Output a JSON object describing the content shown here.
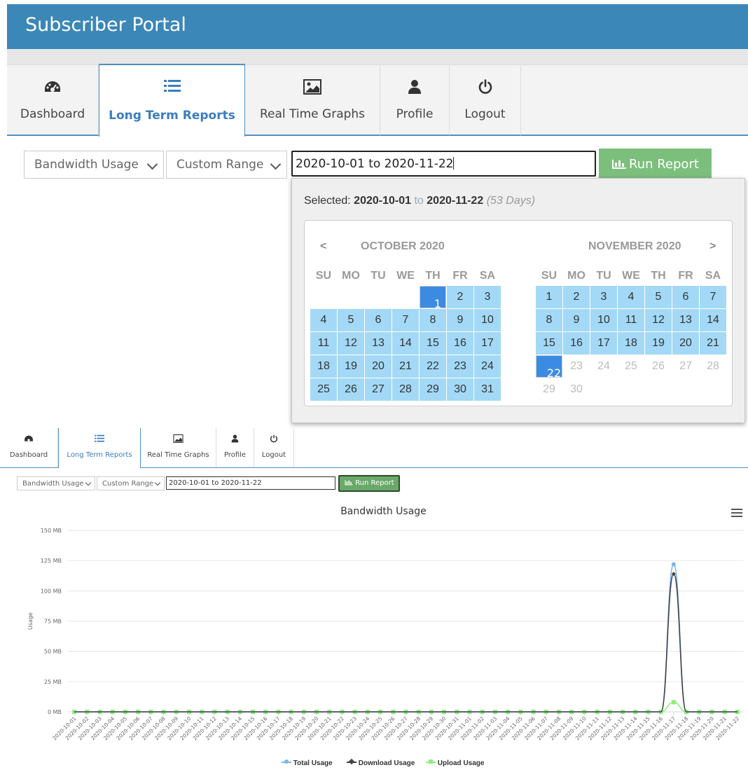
{
  "app": {
    "title": "Subscriber Portal"
  },
  "tabs": [
    {
      "label": "Dashboard",
      "icon": "dashboard-icon"
    },
    {
      "label": "Long Term Reports",
      "icon": "list-icon"
    },
    {
      "label": "Real Time Graphs",
      "icon": "image-icon"
    },
    {
      "label": "Profile",
      "icon": "user-icon"
    },
    {
      "label": "Logout",
      "icon": "power-icon"
    }
  ],
  "controls": {
    "report_type": "Bandwidth Usage",
    "range_type": "Custom Range",
    "date_range": "2020-10-01 to 2020-11-22",
    "run_label": "Run Report"
  },
  "picker": {
    "selected_prefix": "Selected:",
    "start": "2020-10-01",
    "to": "to",
    "end": "2020-11-22",
    "days": "(53 Days)",
    "prev": "<",
    "next": ">",
    "weekdays": [
      "SU",
      "MO",
      "TU",
      "WE",
      "TH",
      "FR",
      "SA"
    ],
    "months": [
      {
        "name": "OCTOBER 2020",
        "first_weekday": 4,
        "days": 31,
        "selected_days": [
          1
        ],
        "in_range_from": 1,
        "in_range_to": 31
      },
      {
        "name": "NOVEMBER 2020",
        "first_weekday": 0,
        "days": 30,
        "selected_days": [
          22
        ],
        "in_range_from": 1,
        "in_range_to": 22
      }
    ]
  },
  "chart_data": {
    "type": "line",
    "title": "Bandwidth Usage",
    "ylabel": "Usage",
    "xlabel": "",
    "ylim": [
      0,
      150
    ],
    "y_ticks": [
      "0 MB",
      "25 MB",
      "50 MB",
      "75 MB",
      "100 MB",
      "125 MB",
      "150 MB"
    ],
    "y_tick_values": [
      0,
      25,
      50,
      75,
      100,
      125,
      150
    ],
    "x": [
      "2020-10-01",
      "2020-10-02",
      "2020-10-03",
      "2020-10-04",
      "2020-10-05",
      "2020-10-06",
      "2020-10-07",
      "2020-10-08",
      "2020-10-09",
      "2020-10-10",
      "2020-10-11",
      "2020-10-12",
      "2020-10-13",
      "2020-10-14",
      "2020-10-15",
      "2020-10-16",
      "2020-10-17",
      "2020-10-18",
      "2020-10-19",
      "2020-10-20",
      "2020-10-21",
      "2020-10-22",
      "2020-10-23",
      "2020-10-24",
      "2020-10-25",
      "2020-10-26",
      "2020-10-27",
      "2020-10-28",
      "2020-10-29",
      "2020-10-30",
      "2020-10-31",
      "2020-11-01",
      "2020-11-02",
      "2020-11-03",
      "2020-11-04",
      "2020-11-05",
      "2020-11-06",
      "2020-11-07",
      "2020-11-08",
      "2020-11-09",
      "2020-11-10",
      "2020-11-11",
      "2020-11-12",
      "2020-11-13",
      "2020-11-14",
      "2020-11-15",
      "2020-11-16",
      "2020-11-17",
      "2020-11-18",
      "2020-11-19",
      "2020-11-20",
      "2020-11-21",
      "2020-11-22"
    ],
    "series": [
      {
        "name": "Total Usage",
        "color": "#7cb5ec",
        "values": [
          0,
          0,
          0,
          0,
          0,
          0,
          0,
          0,
          0,
          0,
          0,
          0,
          0,
          0,
          0,
          0,
          0,
          0,
          0,
          0,
          0,
          0,
          0,
          0,
          0,
          0,
          0,
          0,
          0,
          0,
          0,
          0,
          0,
          0,
          0,
          0,
          0,
          0,
          0,
          0,
          0,
          0,
          0,
          0,
          0,
          0,
          0,
          122,
          0,
          0,
          0,
          0,
          0
        ]
      },
      {
        "name": "Download Usage",
        "color": "#434348",
        "values": [
          0,
          0,
          0,
          0,
          0,
          0,
          0,
          0,
          0,
          0,
          0,
          0,
          0,
          0,
          0,
          0,
          0,
          0,
          0,
          0,
          0,
          0,
          0,
          0,
          0,
          0,
          0,
          0,
          0,
          0,
          0,
          0,
          0,
          0,
          0,
          0,
          0,
          0,
          0,
          0,
          0,
          0,
          0,
          0,
          0,
          0,
          0,
          114,
          0,
          0,
          0,
          0,
          0
        ]
      },
      {
        "name": "Upload Usage",
        "color": "#90ed7d",
        "values": [
          0,
          0,
          0,
          0,
          0,
          0,
          0,
          0,
          0,
          0,
          0,
          0,
          0,
          0,
          0,
          0,
          0,
          0,
          0,
          0,
          0,
          0,
          0,
          0,
          0,
          0,
          0,
          0,
          0,
          0,
          0,
          0,
          0,
          0,
          0,
          0,
          0,
          0,
          0,
          0,
          0,
          0,
          0,
          0,
          0,
          0,
          0,
          8,
          0,
          0,
          0,
          0,
          0
        ]
      }
    ],
    "grid": true,
    "legend": "bottom"
  }
}
